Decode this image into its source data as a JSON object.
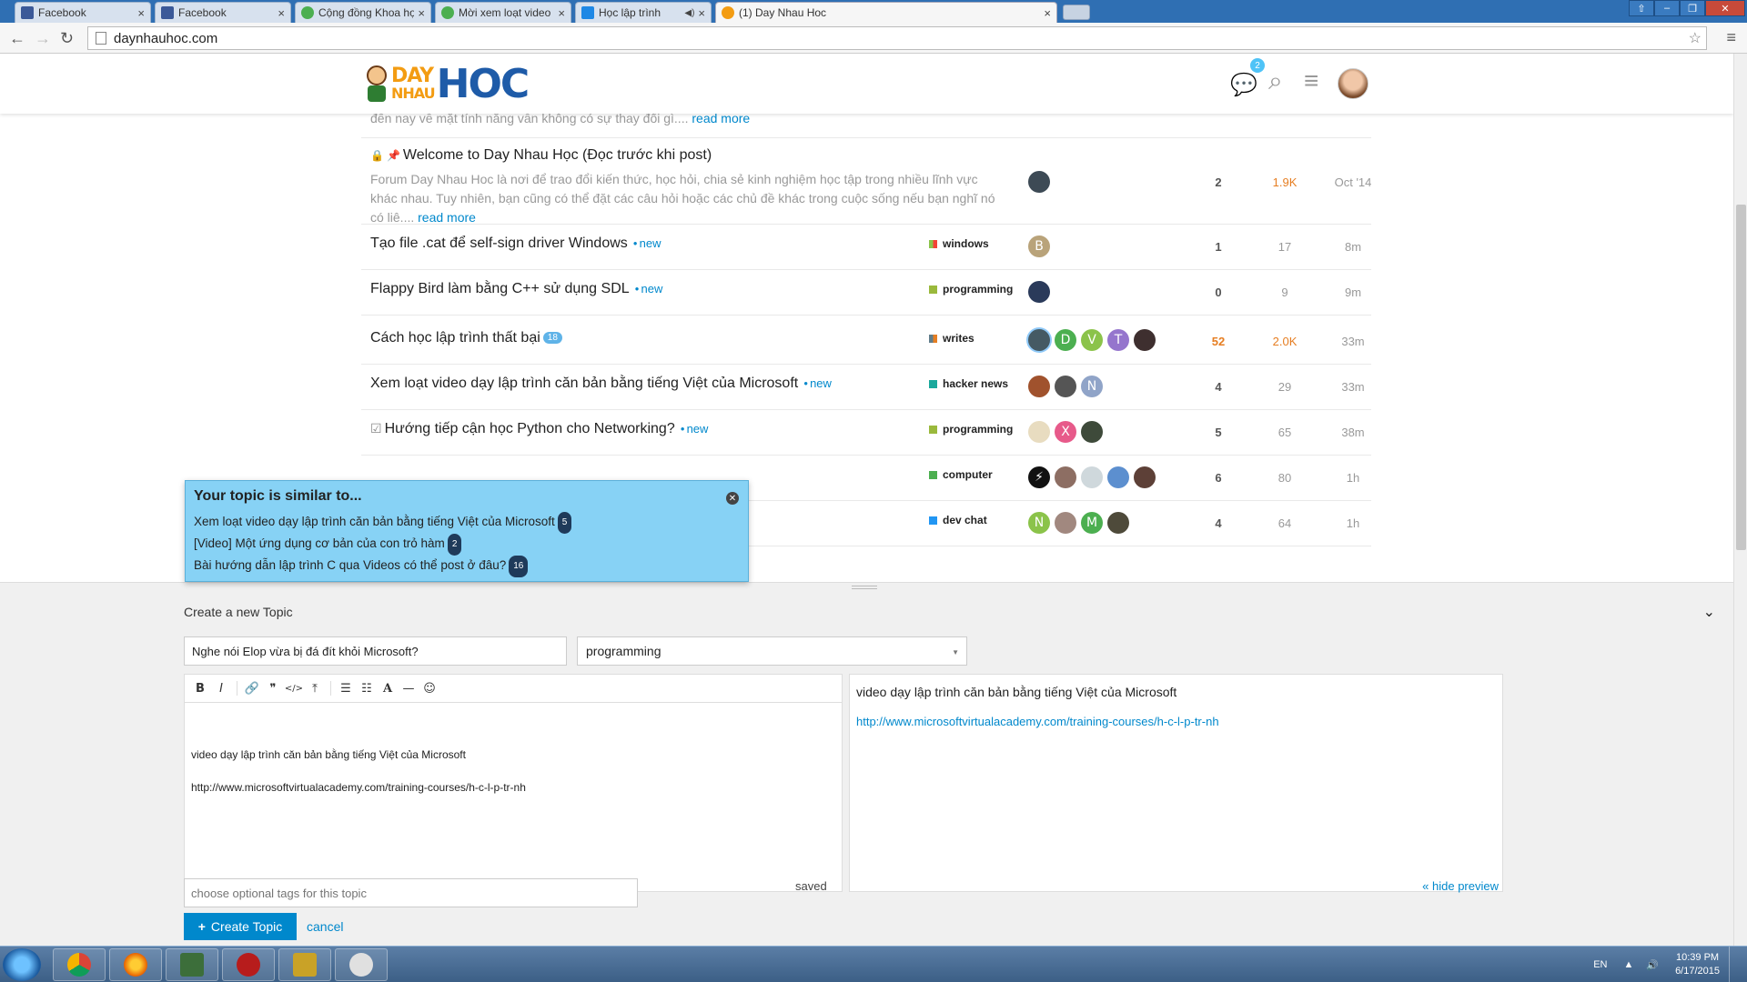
{
  "browser": {
    "tabs": [
      {
        "label": "Facebook",
        "favicon_color": "#3b5998"
      },
      {
        "label": "Facebook",
        "favicon_color": "#3b5998"
      },
      {
        "label": "Cộng đồng Khoa học & C",
        "favicon_color": "#4caf50"
      },
      {
        "label": "Mời xem loạt video dạy lậ",
        "favicon_color": "#4caf50"
      },
      {
        "label": "Học lập trình",
        "favicon_color": "#1e88e5"
      },
      {
        "label": "(1) Day Nhau Hoc",
        "favicon_color": "#f39c12"
      }
    ],
    "active_tab": 5,
    "url": "daynhauhoc.com"
  },
  "header": {
    "logo_day": "DAY",
    "logo_nhau": "NHAU",
    "logo_hoc": "HOC",
    "notification_count": "2"
  },
  "topics": [
    {
      "partial_excerpt": "đến nay về mặt tính năng vẫn không có sự thay đổi gì....",
      "read_more": "read more"
    },
    {
      "title": "Welcome to Day Nhau Học (Đọc trước khi post)",
      "excerpt": "Forum Day Nhau Hoc là nơi để trao đổi kiến thức, học hỏi, chia sẻ kinh nghiệm học tập trong nhiều lĩnh vực khác nhau. Tuy nhiên, bạn cũng có thể đặt các câu hỏi hoặc các chủ đề khác trong cuộc sống nếu bạn nghĩ nó có liê....",
      "read_more": "read more",
      "replies": "2",
      "views": "1.9K",
      "activity": "Oct '14"
    },
    {
      "title": "Tạo file .cat để self-sign driver Windows",
      "new": "new",
      "category": "windows",
      "cat_color": "#8bc34a",
      "cat_color2": "#f44336",
      "replies": "1",
      "views": "17",
      "activity": "8m"
    },
    {
      "title": "Flappy Bird làm bằng C++ sử dụng SDL",
      "new": "new",
      "category": "programming",
      "cat_color": "#9ab93c",
      "replies": "0",
      "views": "9",
      "activity": "9m"
    },
    {
      "title": "Cách học lập trình thất bại",
      "unread": "18",
      "category": "writes",
      "cat_color": "#607d8b",
      "replies": "52",
      "views": "2.0K",
      "activity": "33m"
    },
    {
      "title": "Xem loạt video dạy lập trình căn bản bằng tiếng Việt của Microsoft",
      "new": "new",
      "category": "hacker news",
      "cat_color": "#1aa89c",
      "replies": "4",
      "views": "29",
      "activity": "33m"
    },
    {
      "title": "Hướng tiếp cận học Python cho Networking?",
      "new": "new",
      "category": "programming",
      "cat_color": "#9ab93c",
      "replies": "5",
      "views": "65",
      "activity": "38m"
    },
    {
      "category": "computer",
      "cat_color": "#4caf50",
      "replies": "6",
      "views": "80",
      "activity": "1h"
    },
    {
      "category": "dev chat",
      "cat_color": "#2196f3",
      "replies": "4",
      "views": "64",
      "activity": "1h"
    }
  ],
  "avatar_letters": {
    "t2": [
      "B"
    ],
    "t4": [
      "",
      "D",
      "V",
      "T",
      ""
    ],
    "t5": [
      "",
      "",
      "N"
    ],
    "t6": [
      "",
      "X",
      ""
    ],
    "t8": [
      "N",
      "",
      "M",
      ""
    ]
  },
  "similar": {
    "heading": "Your topic is similar to...",
    "items": [
      {
        "text": "Xem loạt video dạy lập trình căn bản bằng tiếng Việt của Microsoft",
        "count": "5"
      },
      {
        "text": "[Video] Một ứng dụng cơ bản của con trỏ hàm",
        "count": "2"
      },
      {
        "text": "Bài hướng dẫn lập trình C qua Videos có thể post ở đâu?",
        "count": "16"
      }
    ]
  },
  "composer": {
    "title": "Create a new Topic",
    "topic_title": "Nghe nói Elop vừa bị đá đít khỏi Microsoft?",
    "category": "programming",
    "body_line1": "video dạy lập trình căn bản bằng tiếng Việt của Microsoft",
    "body_line2": "http://www.microsoftvirtualacademy.com/training-courses/h-c-l-p-tr-nh",
    "preview_line1": "video dạy lập trình căn bản bằng tiếng Việt của Microsoft",
    "preview_link": "http://www.microsoftvirtualacademy.com/training-courses/h-c-l-p-tr-nh",
    "tags_placeholder": "choose optional tags for this topic",
    "saved": "saved",
    "hide_preview": "« hide preview",
    "create_label": "Create Topic",
    "cancel_label": "cancel"
  },
  "taskbar": {
    "lang": "EN",
    "time": "10:39 PM",
    "date": "6/17/2015"
  }
}
